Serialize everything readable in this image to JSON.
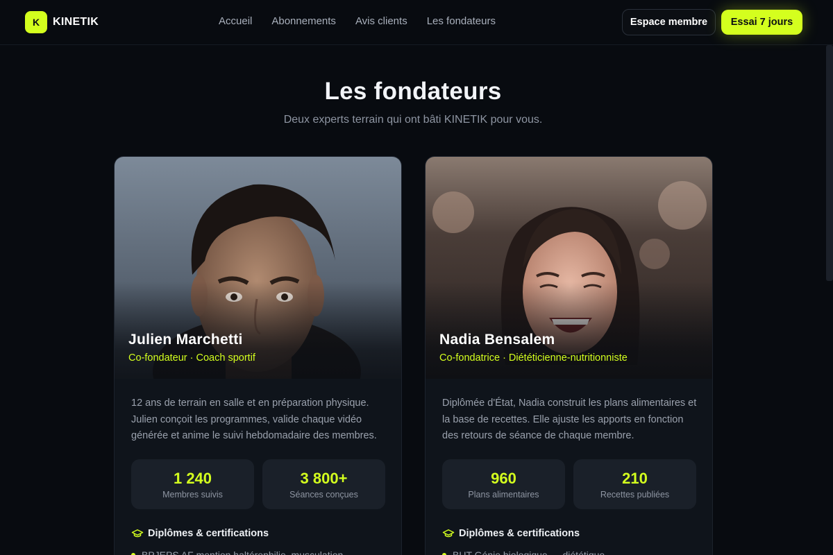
{
  "brand": {
    "logo_letter": "K",
    "name": "KINETIK"
  },
  "nav": {
    "links": [
      "Accueil",
      "Abonnements",
      "Avis clients",
      "Les fondateurs"
    ],
    "member_button": "Espace membre",
    "trial_button": "Essai 7 jours"
  },
  "section": {
    "title": "Les fondateurs",
    "subtitle": "Deux experts terrain qui ont bâti KINETIK pour vous."
  },
  "founders": [
    {
      "name": "Julien Marchetti",
      "role": "Co-fondateur · Coach sportif",
      "bio": "12 ans de terrain en salle et en préparation physique. Julien conçoit les programmes, valide chaque vidéo générée et anime le suivi hebdomadaire des membres.",
      "stats": [
        {
          "value": "1 240",
          "label": "Membres suivis"
        },
        {
          "value": "3 800+",
          "label": "Séances conçues"
        }
      ],
      "diplomas_title": "Diplômes & certifications",
      "diploma_first": "BPJEPS AF mention haltérophilie, musculation"
    },
    {
      "name": "Nadia Bensalem",
      "role": "Co-fondatrice · Diététicienne-nutritionniste",
      "bio": "Diplômée d'État, Nadia construit les plans alimentaires et la base de recettes. Elle ajuste les apports en fonction des retours de séance de chaque membre.",
      "stats": [
        {
          "value": "960",
          "label": "Plans alimentaires"
        },
        {
          "value": "210",
          "label": "Recettes publiées"
        }
      ],
      "diplomas_title": "Diplômes & certifications",
      "diploma_first": "BUT Génie biologique — diététique"
    }
  ],
  "colors": {
    "accent": "#d4ff1e",
    "background": "#080b10",
    "card": "#0f141b",
    "stat_bg": "#1a2029"
  },
  "icons": {
    "diplomas": "graduation-cap-icon"
  }
}
